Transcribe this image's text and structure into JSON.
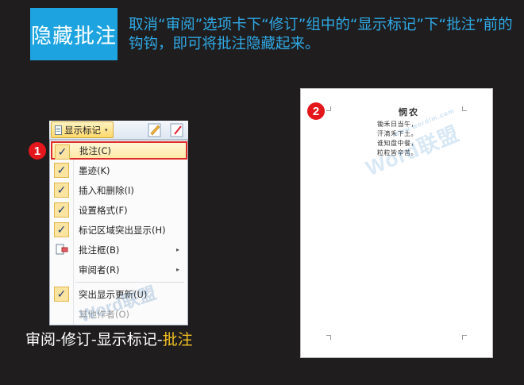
{
  "header": {
    "title": "隐藏批注",
    "description": "取消“审阅”选项卡下“修订”组中的“显示标记”下“批注”前的钩钩，即可将批注隐藏起来。"
  },
  "ribbon": {
    "show_markup_label": "显示标记",
    "show_markup_caret": "▾"
  },
  "menu": {
    "items": [
      {
        "label": "批注(C)",
        "checked": true
      },
      {
        "label": "墨迹(K)",
        "checked": true
      },
      {
        "label": "插入和删除(I)",
        "checked": true
      },
      {
        "label": "设置格式(F)",
        "checked": true
      },
      {
        "label": "标记区域突出显示(H)",
        "checked": true
      },
      {
        "label": "批注框(B)",
        "submenu": true
      },
      {
        "label": "审阅者(R)",
        "submenu": true
      },
      {
        "label": "突出显示更新(U)",
        "checked": true
      },
      {
        "label": "其他作者(O)",
        "disabled": true
      }
    ],
    "check_glyph": "✓",
    "submenu_glyph": "▸"
  },
  "badges": {
    "step1": "1",
    "step2": "2"
  },
  "breadcrumb": {
    "path": "审阅-修订-显示标记-",
    "current": "批注"
  },
  "document": {
    "poem_title": "悯农",
    "lines": [
      "锄禾日当午，",
      "汗滴禾下土。",
      "谁知盘中餐，",
      "粒粒皆辛苦。"
    ],
    "watermark": "Word联盟",
    "watermark_url": "www.wordlm.com"
  },
  "colors": {
    "background": "#1f1d1e",
    "title_bg": "#1da4e0",
    "accent_text": "#2fa9e6",
    "highlight_border": "#e02b2b",
    "badge": "#e4171c",
    "breadcrumb_em": "#f5c224"
  }
}
